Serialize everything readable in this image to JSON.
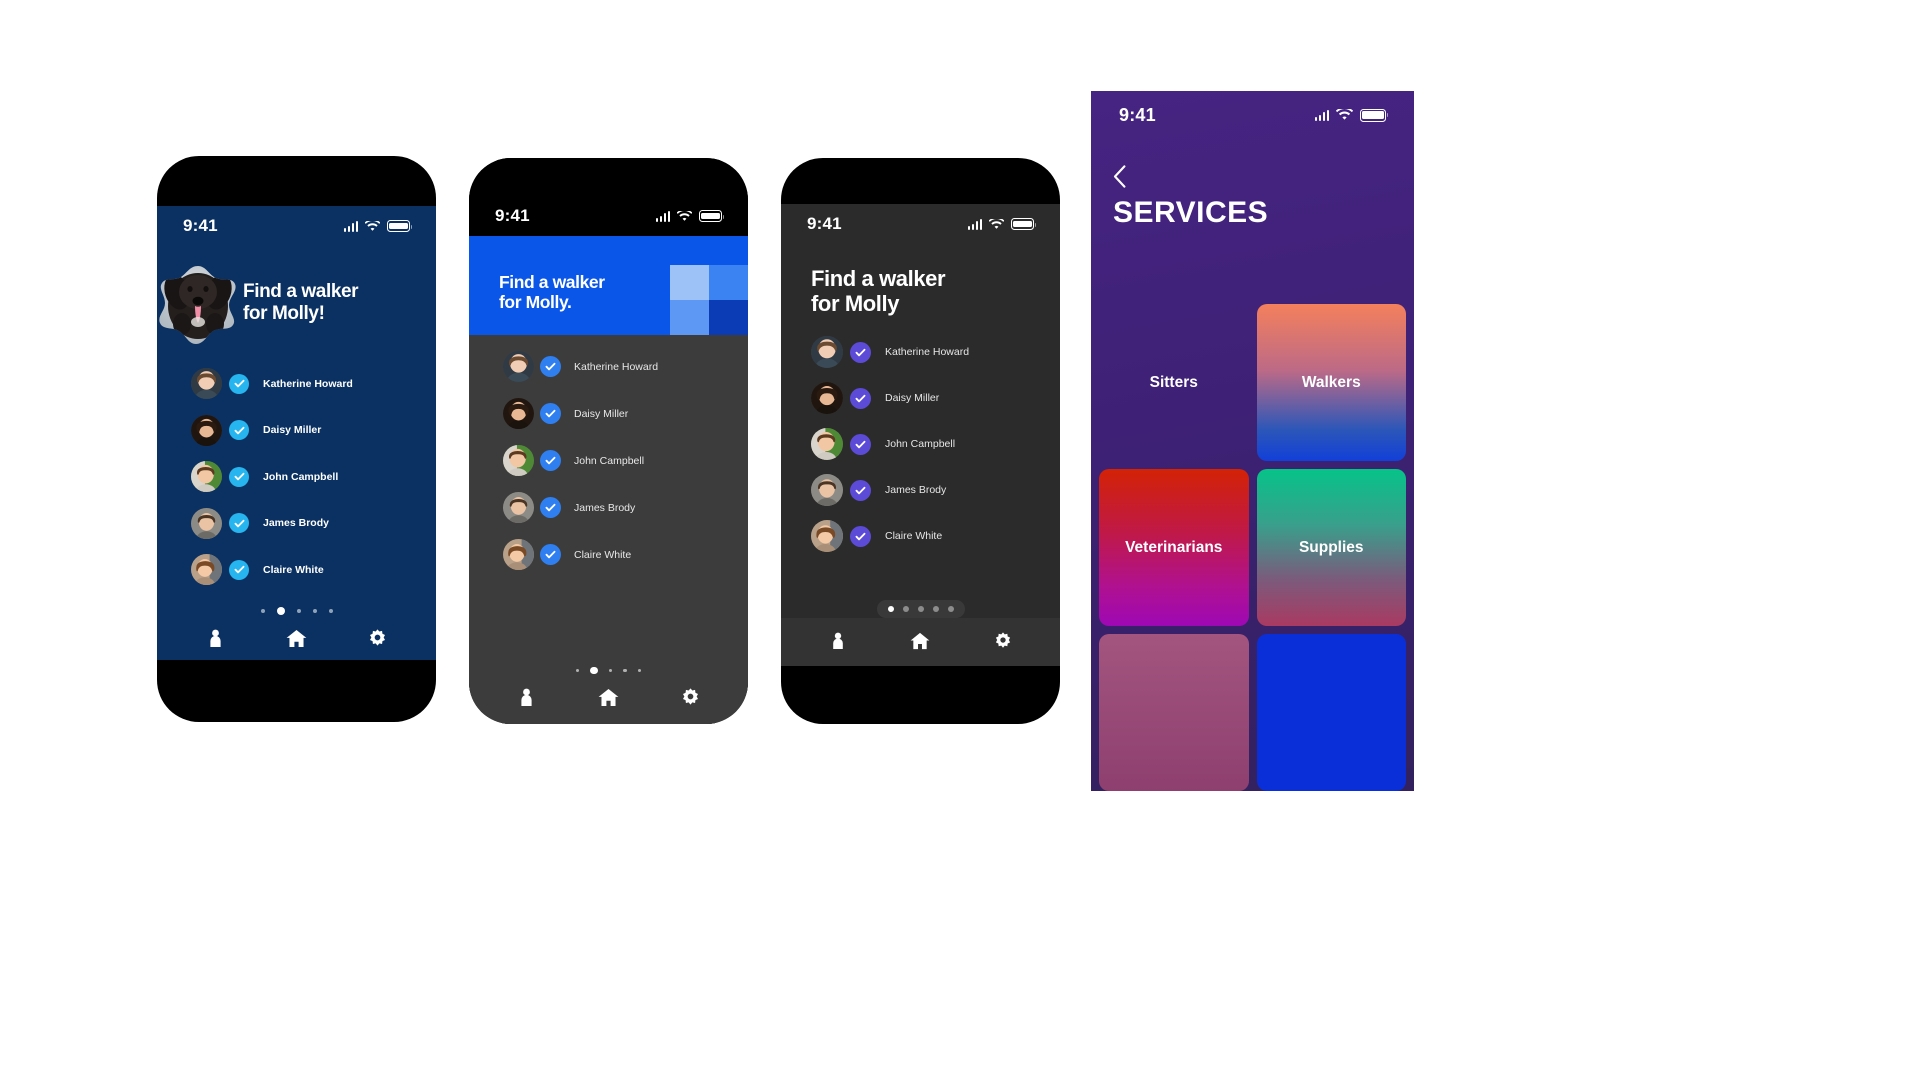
{
  "screens": [
    {
      "id": "phone1",
      "theme_name": "navy",
      "colors": {
        "screen_bg": "#0a3161",
        "check": "#27b5ef",
        "text": "#ffffff"
      },
      "status_bar": {
        "time": "9:41",
        "signal_icon": "cellular-signal-icon",
        "wifi_icon": "wifi-icon",
        "battery_icon": "battery-icon"
      },
      "headline": "Find a walker\nfor Molly!",
      "hero_image_alt": "molly-dog-photo",
      "walkers": [
        {
          "name": "Katherine Howard",
          "checked": true
        },
        {
          "name": "Daisy Miller",
          "checked": true
        },
        {
          "name": "John Campbell",
          "checked": true
        },
        {
          "name": "James Brody",
          "checked": true
        },
        {
          "name": "Claire White",
          "checked": true
        }
      ],
      "pagination": {
        "count": 5,
        "active_index": 1
      },
      "tabs": [
        {
          "icon": "person-icon",
          "label": "Profile"
        },
        {
          "icon": "home-icon",
          "label": "Home"
        },
        {
          "icon": "gear-icon",
          "label": "Settings"
        }
      ]
    },
    {
      "id": "phone2",
      "theme_name": "blue-banner-dark",
      "colors": {
        "banner_bg": "#0a56e8",
        "body_bg": "#3c3c3c",
        "check": "#2f7ff0",
        "text": "#e8e8e8"
      },
      "status_bar": {
        "time": "9:41",
        "signal_icon": "cellular-signal-icon",
        "wifi_icon": "wifi-icon",
        "battery_icon": "battery-icon"
      },
      "headline": "Find a walker\nfor Molly.",
      "banner_swatches": [
        "#9dc2f7",
        "#3b82f3",
        "#5e98f5",
        "#0b3bb5"
      ],
      "walkers": [
        {
          "name": "Katherine Howard",
          "checked": true
        },
        {
          "name": "Daisy Miller",
          "checked": true
        },
        {
          "name": "John Campbell",
          "checked": true
        },
        {
          "name": "James Brody",
          "checked": true
        },
        {
          "name": "Claire White",
          "checked": true
        }
      ],
      "pagination": {
        "count": 5,
        "active_index": 1
      },
      "tabs": [
        {
          "icon": "person-icon",
          "label": "Profile"
        },
        {
          "icon": "home-icon",
          "label": "Home"
        },
        {
          "icon": "gear-icon",
          "label": "Settings"
        }
      ]
    },
    {
      "id": "phone3",
      "theme_name": "dark",
      "colors": {
        "screen_bg": "#2b2b2b",
        "check": "#5b4bd6",
        "text": "#e6e6e6"
      },
      "status_bar": {
        "time": "9:41",
        "signal_icon": "cellular-signal-icon",
        "wifi_icon": "wifi-icon",
        "battery_icon": "battery-icon"
      },
      "headline": "Find a walker\nfor Molly",
      "walkers": [
        {
          "name": "Katherine Howard",
          "checked": true
        },
        {
          "name": "Daisy Miller",
          "checked": true
        },
        {
          "name": "John Campbell",
          "checked": true
        },
        {
          "name": "James Brody",
          "checked": true
        },
        {
          "name": "Claire White",
          "checked": true
        }
      ],
      "pagination": {
        "count": 5,
        "active_index": 0
      },
      "tabs": [
        {
          "icon": "person-icon",
          "label": "Profile"
        },
        {
          "icon": "home-icon",
          "label": "Home"
        },
        {
          "icon": "gear-icon",
          "label": "Settings"
        }
      ]
    }
  ],
  "services": {
    "status_bar": {
      "time": "9:41",
      "signal_icon": "cellular-signal-icon",
      "wifi_icon": "wifi-icon",
      "battery_icon": "battery-icon"
    },
    "back_icon": "chevron-left-icon",
    "title": "SERVICES",
    "colors": {
      "bg_top": "#462482",
      "bg_bottom": "#32215e"
    },
    "tiles": [
      {
        "label": "Sitters",
        "gradient": "none",
        "visible_card": false
      },
      {
        "label": "Walkers",
        "gradient": "linear-gradient(180deg,#f4805c 0%,#bd6a86 42%,#2c57b8 80%,#1240d8 100%)",
        "visible_card": true
      },
      {
        "label": "Veterinarians",
        "gradient": "linear-gradient(180deg,#d32205 0%,#c01946 40%,#b01190 75%,#9e08b4 100%)",
        "visible_card": true
      },
      {
        "label": "Supplies",
        "gradient": "linear-gradient(180deg,#06c389 0%,#38a08c 35%,#7a5b7c 70%,#a93a62 100%)",
        "visible_card": true
      },
      {
        "label": "",
        "gradient": "linear-gradient(180deg,#9b3fa0 0%,#8c1fa0 100%)",
        "visible_card": true
      },
      {
        "label": "",
        "gradient": "linear-gradient(180deg,#8b3b7a 0%,#7c2d65 100%)",
        "visible_card": true
      },
      {
        "label": "",
        "gradient": "linear-gradient(180deg,#a3557f 0%,#8e3f6f 100%)",
        "visible_card": true
      },
      {
        "label": "",
        "gradient": "linear-gradient(180deg,#0a2fd8 0%,#0a2fd8 100%)",
        "visible_card": true
      }
    ]
  }
}
